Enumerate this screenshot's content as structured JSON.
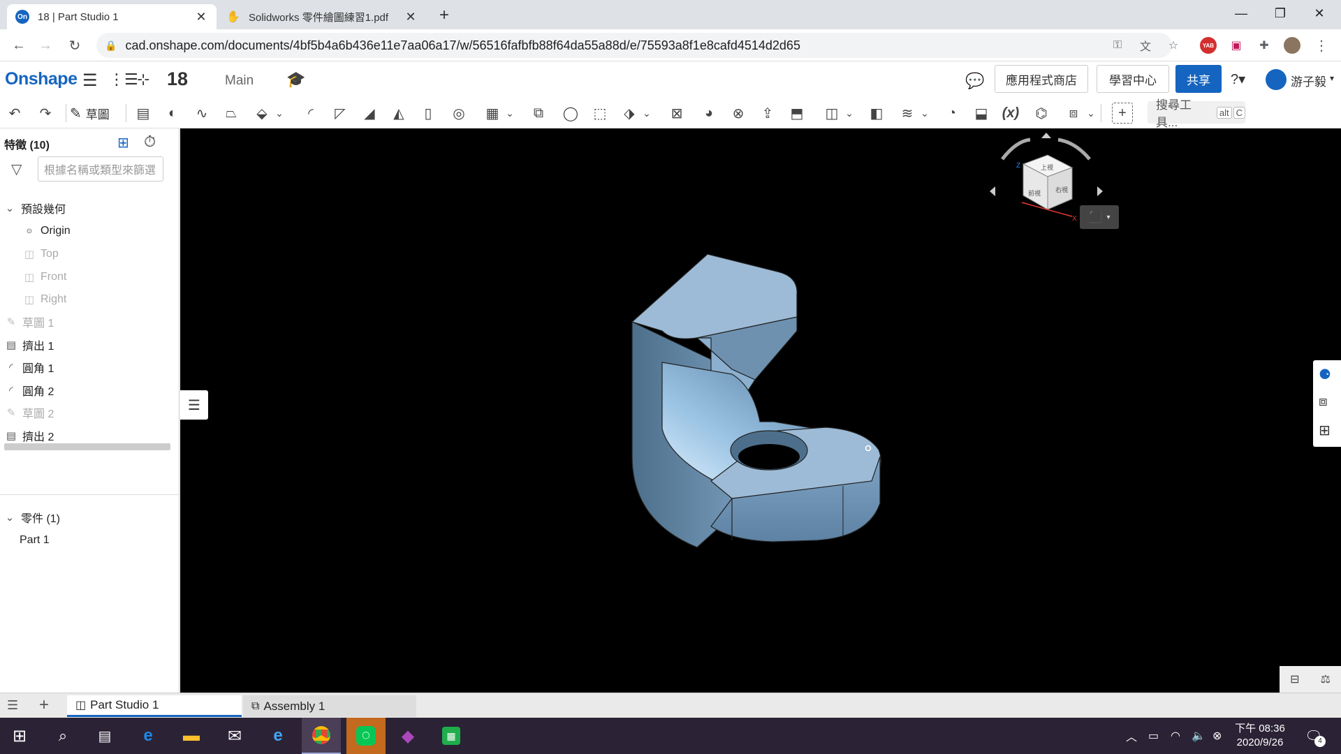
{
  "browser": {
    "tabs": [
      {
        "title": "18 | Part Studio 1",
        "favicon": "On"
      },
      {
        "title": "Solidworks 零件繪圖練習1.pdf",
        "favicon": "pdf"
      }
    ],
    "url": "cad.onshape.com/documents/4bf5b4a6b436e11e7aa06a17/w/56516fafbfb88f64da55a88d/e/75593a8f1e8cafd4514d2d65",
    "extension_badge": "YAB"
  },
  "header": {
    "logo": "Onshape",
    "document_name": "18",
    "branch": "Main",
    "app_store": "應用程式商店",
    "learning_center": "學習中心",
    "share": "共享",
    "user": "游子毅"
  },
  "toolbar": {
    "sketch_label": "草圖",
    "search_tools": "搜尋工具...",
    "search_kbd1": "alt",
    "search_kbd2": "C"
  },
  "feature_tree": {
    "title": "特徵 (10)",
    "filter_placeholder": "根據名稱或類型來篩選",
    "default_geometry": "預設幾何",
    "items": [
      {
        "label": "Origin",
        "icon": "origin-icon",
        "dim": false
      },
      {
        "label": "Top",
        "icon": "plane-icon",
        "dim": true
      },
      {
        "label": "Front",
        "icon": "plane-icon",
        "dim": true
      },
      {
        "label": "Right",
        "icon": "plane-icon",
        "dim": true
      },
      {
        "label": "草圖 1",
        "icon": "sketch-icon",
        "dim": true
      },
      {
        "label": "擠出 1",
        "icon": "extrude-icon",
        "dim": false
      },
      {
        "label": "圓角 1",
        "icon": "fillet-icon",
        "dim": false
      },
      {
        "label": "圓角 2",
        "icon": "fillet-icon",
        "dim": false
      },
      {
        "label": "草圖 2",
        "icon": "sketch-icon",
        "dim": true
      },
      {
        "label": "擠出 2",
        "icon": "extrude-icon",
        "dim": false
      }
    ],
    "parts_title": "零件 (1)",
    "parts": [
      "Part 1"
    ]
  },
  "viewcube": {
    "top": "上視",
    "front": "前視",
    "right": "右視",
    "axis_x": "X",
    "axis_z": "Z"
  },
  "bottom_tabs": [
    {
      "label": "Part Studio 1",
      "active": true
    },
    {
      "label": "Assembly 1",
      "active": false
    }
  ],
  "taskbar": {
    "time": "下午 08:36",
    "date": "2020/9/26",
    "notifications": "4"
  },
  "colors": {
    "accent": "#1565c0",
    "viewport_bg": "#000000",
    "part_color": "#9dbbd6"
  }
}
